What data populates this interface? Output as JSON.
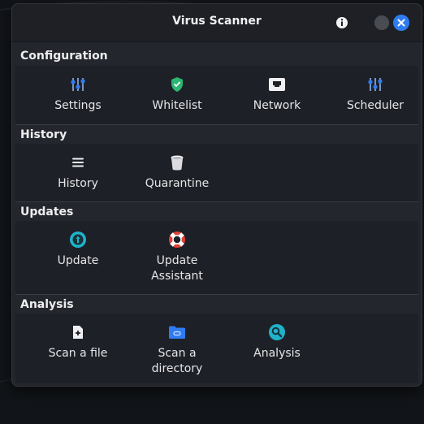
{
  "window": {
    "title": "Virus Scanner"
  },
  "sections": {
    "configuration": {
      "title": "Configuration",
      "items": [
        {
          "label": "Settings",
          "icon": "sliders-icon"
        },
        {
          "label": "Whitelist",
          "icon": "shield-check-icon"
        },
        {
          "label": "Network",
          "icon": "network-port-icon"
        },
        {
          "label": "Scheduler",
          "icon": "sliders-icon"
        }
      ]
    },
    "history": {
      "title": "History",
      "items": [
        {
          "label": "History",
          "icon": "list-icon"
        },
        {
          "label": "Quarantine",
          "icon": "trash-bin-icon"
        }
      ]
    },
    "updates": {
      "title": "Updates",
      "items": [
        {
          "label": "Update",
          "icon": "update-icon"
        },
        {
          "label": "Update\nAssistant",
          "icon": "lifebuoy-icon"
        }
      ]
    },
    "analysis": {
      "title": "Analysis",
      "items": [
        {
          "label": "Scan a file",
          "icon": "file-add-icon"
        },
        {
          "label": "Scan a\ndirectory",
          "icon": "folder-icon"
        },
        {
          "label": "Analysis",
          "icon": "search-icon"
        }
      ]
    }
  },
  "colors": {
    "accent": "#2f7cf0",
    "window_bg": "#24262d",
    "panel_bg": "#1e2027",
    "shield_green": "#2bb673",
    "lifebuoy_red": "#e0403a",
    "teal": "#1fb3c9"
  }
}
